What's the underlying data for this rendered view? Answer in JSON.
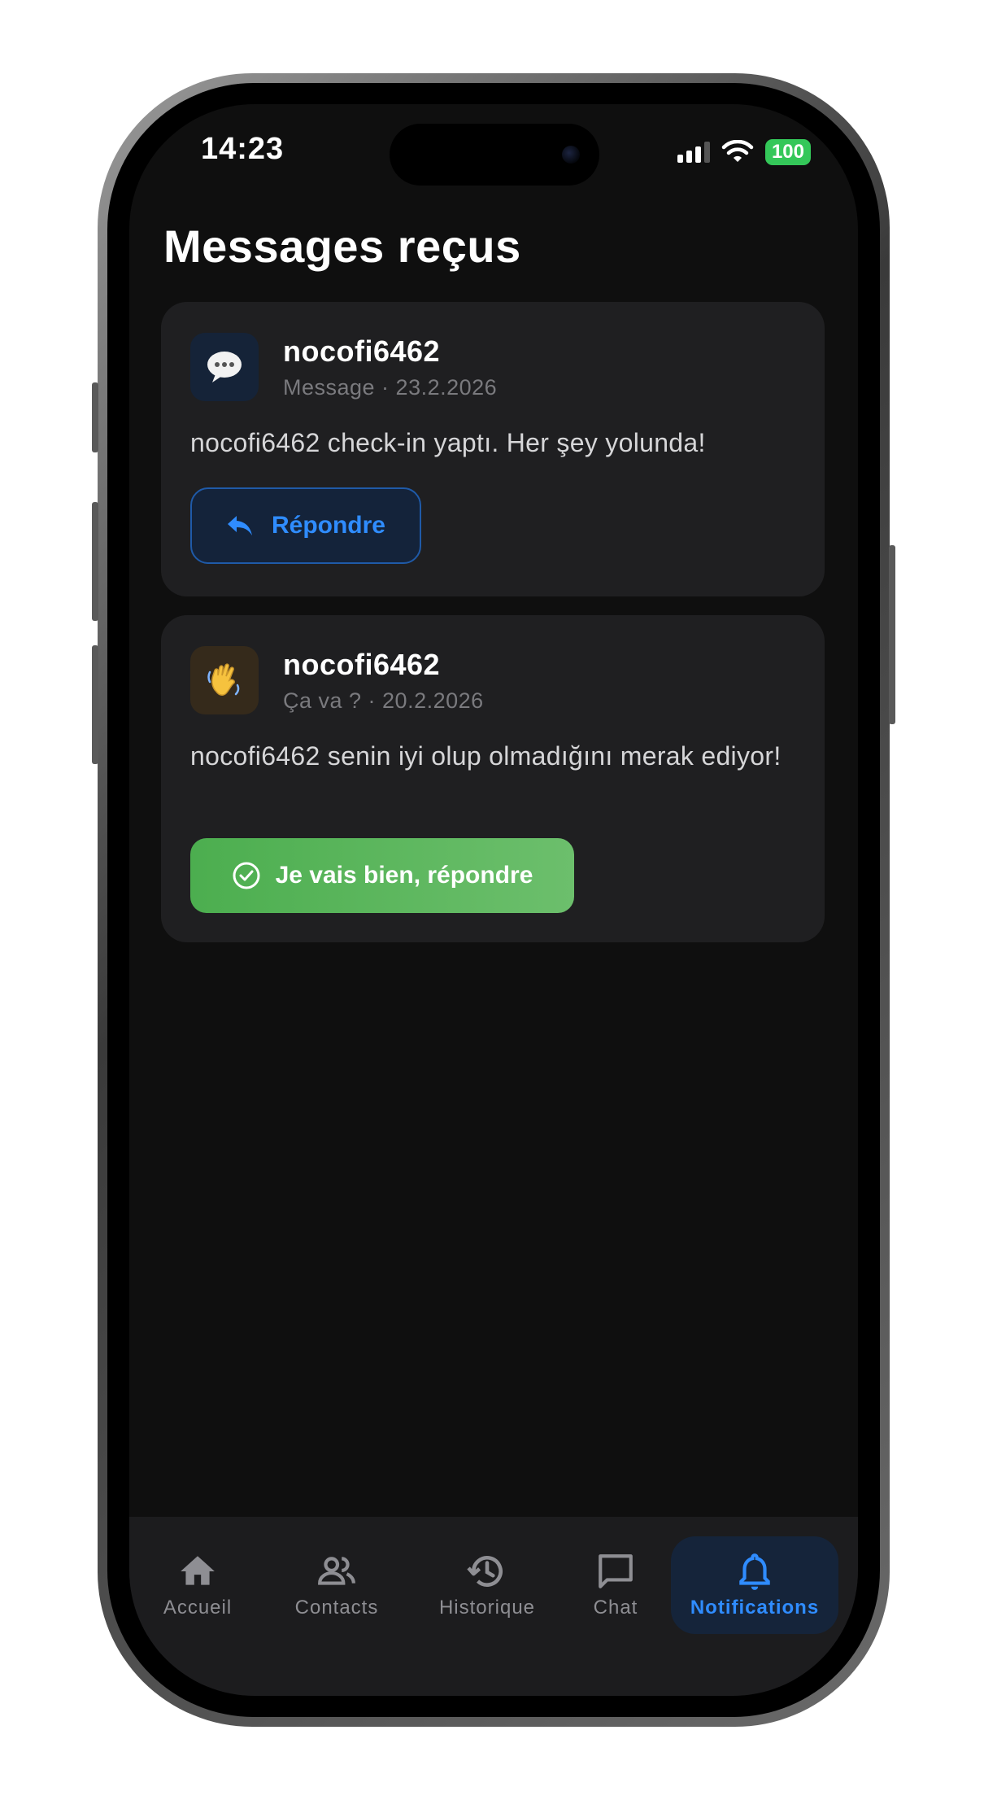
{
  "status_bar": {
    "time": "14:23",
    "battery": "100"
  },
  "page": {
    "title": "Messages reçus"
  },
  "messages": [
    {
      "sender": "nocofi6462",
      "meta": "Message · 23.2.2026",
      "text": "nocofi6462 check-in yaptı. Her şey yolunda!",
      "icon": "speech-bubble-icon",
      "action_label": "Répondre"
    },
    {
      "sender": "nocofi6462",
      "meta": "Ça va ? · 20.2.2026",
      "text": "nocofi6462 senin iyi olup olmadığını merak ediyor!",
      "icon": "waving-hand-icon",
      "action_label": "Je vais bien, répondre"
    }
  ],
  "tabs": [
    {
      "label": "Accueil",
      "icon": "home-icon"
    },
    {
      "label": "Contacts",
      "icon": "contacts-icon"
    },
    {
      "label": "Historique",
      "icon": "history-icon"
    },
    {
      "label": "Chat",
      "icon": "chat-icon"
    },
    {
      "label": "Notifications",
      "icon": "bell-icon",
      "active": true
    }
  ],
  "colors": {
    "accent": "#2f8cff",
    "success": "#4cae4f",
    "background": "#0f0f0f",
    "card": "#1f1f21"
  }
}
